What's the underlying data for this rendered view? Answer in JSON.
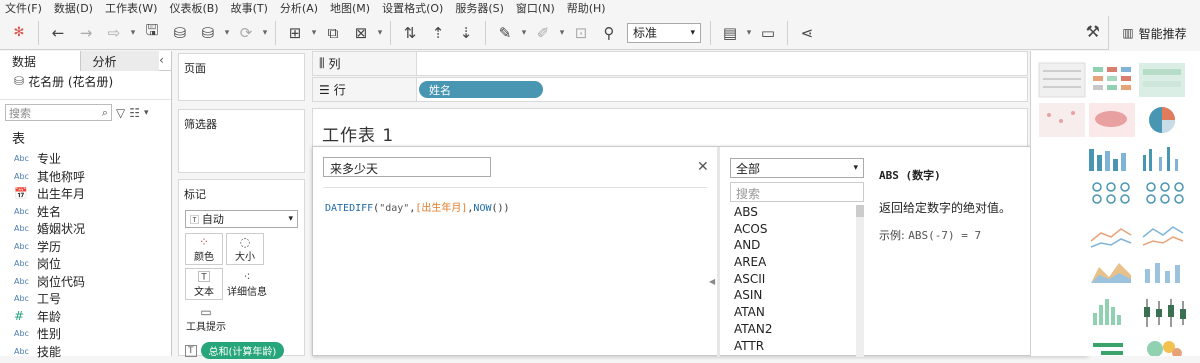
{
  "menu": [
    "文件(F)",
    "数据(D)",
    "工作表(W)",
    "仪表板(B)",
    "故事(T)",
    "分析(A)",
    "地图(M)",
    "设置格式(O)",
    "服务器(S)",
    "窗口(N)",
    "帮助(H)"
  ],
  "toolbar": {
    "fit_select": "标准",
    "smart_label": "智能推荐"
  },
  "left_pane": {
    "tab_data": "数据",
    "tab_analysis": "分析",
    "datasource": "花名册 (花名册)",
    "search_placeholder": "搜索",
    "fields_heading": "表",
    "fields": [
      {
        "type": "Abc",
        "name": "专业"
      },
      {
        "type": "Abc",
        "name": "其他称呼"
      },
      {
        "type": "date",
        "name": "出生年月"
      },
      {
        "type": "Abc",
        "name": "姓名"
      },
      {
        "type": "Abc",
        "name": "婚姻状况"
      },
      {
        "type": "Abc",
        "name": "学历"
      },
      {
        "type": "Abc",
        "name": "岗位"
      },
      {
        "type": "Abc",
        "name": "岗位代码"
      },
      {
        "type": "Abc",
        "name": "工号"
      },
      {
        "type": "#",
        "name": "年龄"
      },
      {
        "type": "Abc",
        "name": "性别"
      },
      {
        "type": "Abc",
        "name": "技能"
      }
    ]
  },
  "cards": {
    "pages": "页面",
    "filters": "筛选器",
    "marks": "标记",
    "marks_type": "自动",
    "mark_buttons": [
      "颜色",
      "大小",
      "文本",
      "详细信息",
      "工具提示"
    ],
    "marks_pill": "总和(计算年龄)"
  },
  "shelves": {
    "columns": "列",
    "rows": "行",
    "rows_pill": "姓名"
  },
  "sheet": {
    "title": "工作表 1"
  },
  "calc": {
    "name": "来多少天",
    "formula": {
      "func": "DATEDIFF",
      "arg1": "\"day\"",
      "field": "[出生年月]",
      "func2": "NOW"
    },
    "category": "全部",
    "search_placeholder": "搜索",
    "functions": [
      "ABS",
      "ACOS",
      "AND",
      "AREA",
      "ASCII",
      "ASIN",
      "ATAN",
      "ATAN2",
      "ATTR"
    ],
    "help_title": "ABS (数字)",
    "help_desc": "返回给定数字的绝对值。",
    "help_example_label": "示例:",
    "help_example_code": "ABS(-7) = 7"
  },
  "colors": {
    "pill_blue": "#4996b2",
    "pill_green": "#27a57b",
    "func_blue": "#1f6ba8",
    "field_orange": "#e07b2a"
  }
}
